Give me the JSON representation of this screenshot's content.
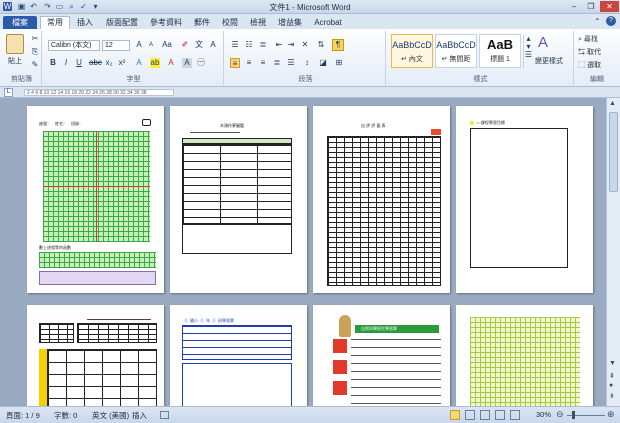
{
  "window": {
    "title": "文件1 - Microsoft Word"
  },
  "tabs": {
    "file": "檔案",
    "items": [
      "常用",
      "插入",
      "版面配置",
      "參考資料",
      "郵件",
      "校閱",
      "檢視",
      "增益集",
      "Acrobat"
    ]
  },
  "ribbon": {
    "clipboard": {
      "label": "剪貼簿",
      "paste": "貼上"
    },
    "font": {
      "label": "字型",
      "font_name": "Calibri (本文)",
      "font_size": "12"
    },
    "paragraph": {
      "label": "段落"
    },
    "styles": {
      "label": "樣式",
      "items": [
        {
          "sample": "AaBbCcD",
          "name": "↵ 內文"
        },
        {
          "sample": "AaBbCcD",
          "name": "↵ 無間距"
        },
        {
          "sample": "AaB",
          "name": "標題 1"
        }
      ],
      "change": "變更樣式"
    },
    "editing": {
      "label": "編輯",
      "find": "尋找",
      "replace": "取代",
      "select": "選取"
    }
  },
  "ruler": {
    "text": "2 4 6 8 10 12 14 16 18 20 22 24 26 28 30 32 34 36 38"
  },
  "pages": {
    "p1_title": "座號：　姓名：　班級：",
    "p1_caption": "數上述相等的函數",
    "p2_title": "木頭作夢圖鑑",
    "p3_title": "自 評 評 量 表",
    "p4_title": "○○課程學習目標",
    "p6_title": "（）國小（）年（）班學習單",
    "p7_title": "自然科學探究學習單"
  },
  "status": {
    "page": "頁面: 1 / 9",
    "words": "字數: 0",
    "lang": "英文 (美國)",
    "mode": "插入",
    "zoom": "30%"
  }
}
